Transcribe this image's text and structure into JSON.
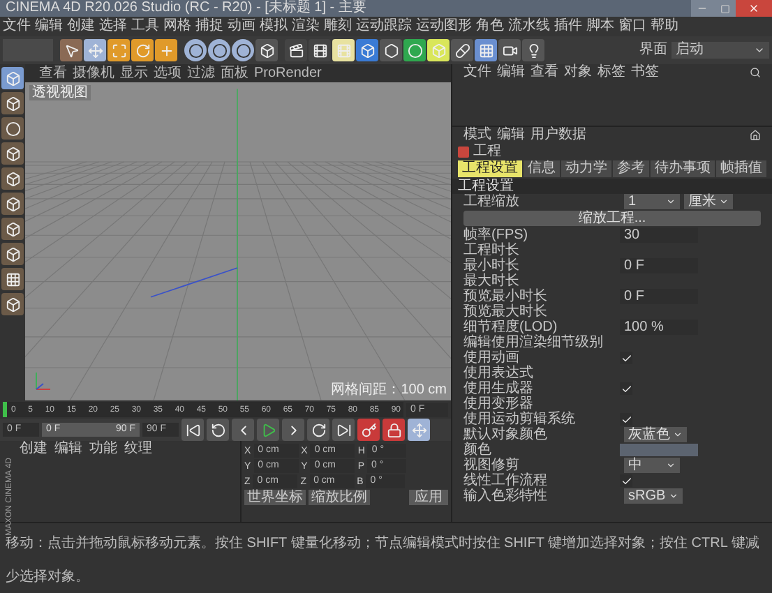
{
  "window": {
    "title": "CINEMA 4D R20.026 Studio (RC - R20) - [未标题 1] - 主要"
  },
  "menu": [
    "文件",
    "编辑",
    "创建",
    "选择",
    "工具",
    "网格",
    "捕捉",
    "动画",
    "模拟",
    "渲染",
    "雕刻",
    "运动跟踪",
    "运动图形",
    "角色",
    "流水线",
    "插件",
    "脚本",
    "窗口",
    "帮助"
  ],
  "layout_menu": {
    "label": "界面",
    "value": "启动"
  },
  "viewport": {
    "menu": [
      "查看",
      "摄像机",
      "显示",
      "选项",
      "过滤",
      "面板",
      "ProRender"
    ],
    "view_label": "透视视图",
    "grid_spacing": "网格间距：100 cm"
  },
  "object_manager": {
    "menu": [
      "文件",
      "编辑",
      "查看",
      "对象",
      "标签",
      "书签"
    ]
  },
  "attributes": {
    "menu": [
      "模式",
      "编辑",
      "用户数据"
    ],
    "object": "工程",
    "tabs": [
      {
        "label": "工程设置",
        "selected": true
      },
      {
        "label": "信息",
        "selected": false
      },
      {
        "label": "动力学",
        "selected": false
      },
      {
        "label": "参考",
        "selected": false
      },
      {
        "label": "待办事项",
        "selected": false
      },
      {
        "label": "帧插值",
        "selected": false
      }
    ],
    "section": "工程设置",
    "rows": [
      {
        "kind": "dropdown",
        "label": "工程缩放",
        "value": "1",
        "unit": "厘米"
      },
      {
        "kind": "button",
        "label": "缩放工程..."
      },
      {
        "kind": "number",
        "label": "帧率(FPS)",
        "value": "30"
      },
      {
        "kind": "label",
        "label": "工程时长"
      },
      {
        "kind": "number",
        "label": "最小时长",
        "value": "0 F"
      },
      {
        "kind": "label",
        "label": "最大时长"
      },
      {
        "kind": "number",
        "label": "预览最小时长",
        "value": "0 F"
      },
      {
        "kind": "label",
        "label": "预览最大时长"
      },
      {
        "kind": "number",
        "label": "细节程度(LOD)",
        "value": "100 %"
      },
      {
        "kind": "label",
        "label": "编辑使用渲染细节级别"
      },
      {
        "kind": "check",
        "label": "使用动画",
        "checked": true
      },
      {
        "kind": "label",
        "label": "使用表达式"
      },
      {
        "kind": "check",
        "label": "使用生成器",
        "checked": true
      },
      {
        "kind": "label",
        "label": "使用变形器"
      },
      {
        "kind": "check",
        "label": "使用运动剪辑系统",
        "checked": true
      },
      {
        "kind": "dropdown",
        "label": "默认对象颜色",
        "value": "灰蓝色"
      },
      {
        "kind": "color",
        "label": "颜色"
      },
      {
        "kind": "dropdown",
        "label": "视图修剪",
        "value": "中"
      },
      {
        "kind": "check",
        "label": "线性工作流程",
        "checked": true
      },
      {
        "kind": "dropdown",
        "label": "输入色彩特性",
        "value": "sRGB"
      }
    ]
  },
  "timeline": {
    "ticks": [
      "0",
      "5",
      "10",
      "15",
      "20",
      "25",
      "30",
      "35",
      "40",
      "45",
      "50",
      "55",
      "60",
      "65",
      "70",
      "75",
      "80",
      "85",
      "90"
    ],
    "current": "0 F",
    "playhead": {
      "level": 0
    }
  },
  "transport": {
    "start": "0 F",
    "range_start": "0 F",
    "range_end": "90 F",
    "end": "90 F",
    "range": {
      "level": 1
    }
  },
  "material_manager": {
    "menu": [
      "创建",
      "编辑",
      "功能",
      "纹理"
    ]
  },
  "coordinates": {
    "rows": [
      {
        "axis": "X",
        "position": "0 cm",
        "size_axis": "X",
        "size": "0 cm",
        "rotation_axis": "H",
        "rotation": "0 °"
      },
      {
        "axis": "Y",
        "position": "0 cm",
        "size_axis": "Y",
        "size": "0 cm",
        "rotation_axis": "P",
        "rotation": "0 °"
      },
      {
        "axis": "Z",
        "position": "0 cm",
        "size_axis": "Z",
        "size": "0 cm",
        "rotation_axis": "B",
        "rotation": "0 °"
      }
    ],
    "mode": "世界坐标",
    "size_mode": "缩放比例",
    "apply": "应用"
  },
  "logo": "MAXON CINEMA 4D",
  "status_bar": "移动：点击并拖动鼠标移动元素。按住 SHIFT 键量化移动；节点编辑模式时按住 SHIFT 键增加选择对象；按住 CTRL 键减少选择对象。"
}
